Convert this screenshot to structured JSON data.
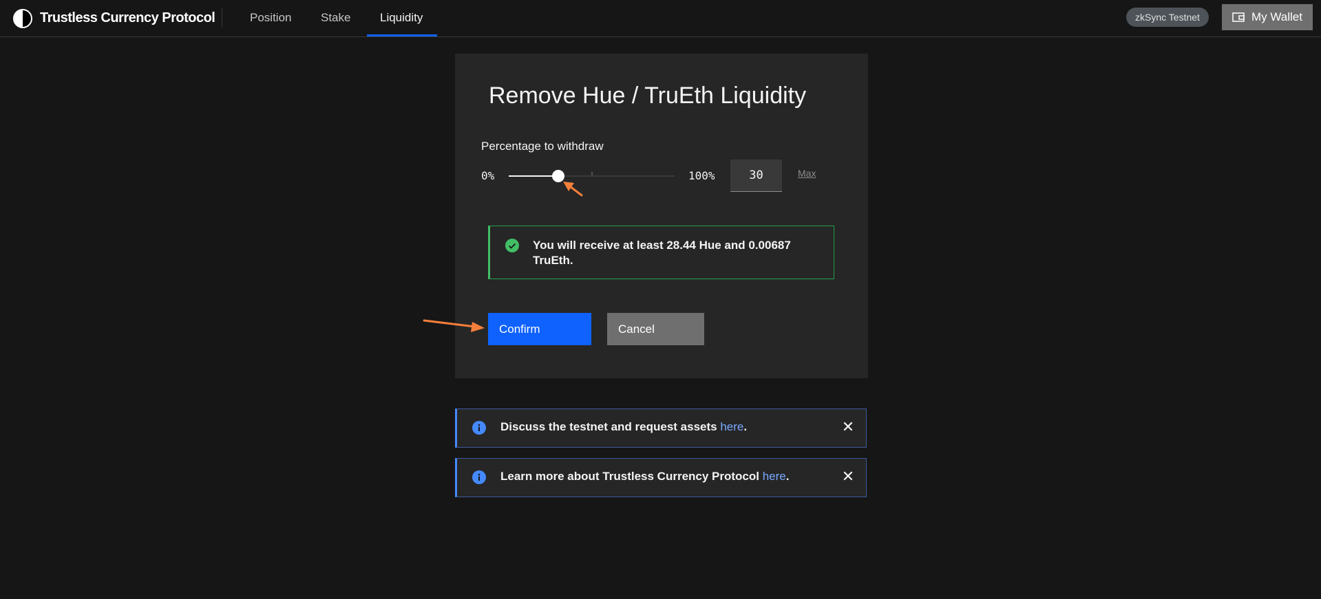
{
  "header": {
    "brand": "Trustless Currency Protocol",
    "nav": [
      {
        "label": "Position"
      },
      {
        "label": "Stake"
      },
      {
        "label": "Liquidity",
        "active": true
      }
    ],
    "network_badge": "zkSync Testnet",
    "wallet_label": "My Wallet"
  },
  "card": {
    "title": "Remove Hue / TruEth Liquidity",
    "slider_label": "Percentage to withdraw",
    "min_label": "0%",
    "max_label": "100%",
    "value": "30",
    "max_link": "Max",
    "notice": "You will receive at least 28.44 Hue and 0.00687 TruEth.",
    "confirm": "Confirm",
    "cancel": "Cancel"
  },
  "banners": [
    {
      "text": "Discuss the testnet and request assets ",
      "link": "here",
      "suffix": "."
    },
    {
      "text": "Learn more about Trustless Currency Protocol ",
      "link": "here",
      "suffix": "."
    }
  ],
  "colors": {
    "accent": "#0f62fe",
    "success": "#42be65",
    "info": "#4589ff",
    "annotation": "#f47f3b"
  }
}
